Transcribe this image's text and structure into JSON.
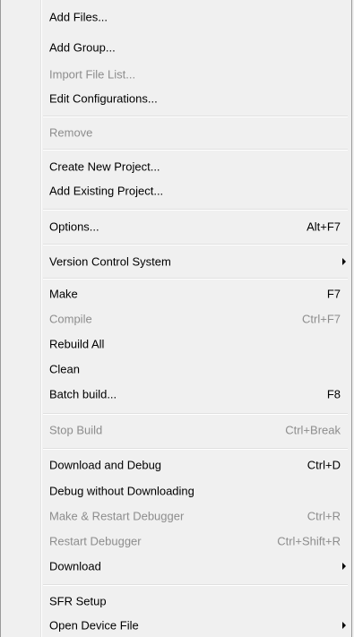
{
  "menu": {
    "items": [
      {
        "label": "Add Files...",
        "shortcut": "",
        "enabled": true,
        "submenu": false
      },
      {
        "label": "Add Group...",
        "shortcut": "",
        "enabled": true,
        "submenu": false
      },
      {
        "label": "Import File List...",
        "shortcut": "",
        "enabled": false,
        "submenu": false
      },
      {
        "label": "Edit Configurations...",
        "shortcut": "",
        "enabled": true,
        "submenu": false
      },
      {
        "label": "Remove",
        "shortcut": "",
        "enabled": false,
        "submenu": false
      },
      {
        "label": "Create New Project...",
        "shortcut": "",
        "enabled": true,
        "submenu": false
      },
      {
        "label": "Add Existing Project...",
        "shortcut": "",
        "enabled": true,
        "submenu": false
      },
      {
        "label": "Options...",
        "shortcut": "Alt+F7",
        "enabled": true,
        "submenu": false
      },
      {
        "label": "Version Control System",
        "shortcut": "",
        "enabled": true,
        "submenu": true
      },
      {
        "label": "Make",
        "shortcut": "F7",
        "enabled": true,
        "submenu": false
      },
      {
        "label": "Compile",
        "shortcut": "Ctrl+F7",
        "enabled": false,
        "submenu": false
      },
      {
        "label": "Rebuild All",
        "shortcut": "",
        "enabled": true,
        "submenu": false
      },
      {
        "label": "Clean",
        "shortcut": "",
        "enabled": true,
        "submenu": false
      },
      {
        "label": "Batch build...",
        "shortcut": "F8",
        "enabled": true,
        "submenu": false
      },
      {
        "label": "Stop Build",
        "shortcut": "Ctrl+Break",
        "enabled": false,
        "submenu": false
      },
      {
        "label": "Download and Debug",
        "shortcut": "Ctrl+D",
        "enabled": true,
        "submenu": false
      },
      {
        "label": "Debug without Downloading",
        "shortcut": "",
        "enabled": true,
        "submenu": false
      },
      {
        "label": "Make & Restart Debugger",
        "shortcut": "Ctrl+R",
        "enabled": false,
        "submenu": false
      },
      {
        "label": "Restart Debugger",
        "shortcut": "Ctrl+Shift+R",
        "enabled": false,
        "submenu": false
      },
      {
        "label": "Download",
        "shortcut": "",
        "enabled": true,
        "submenu": true
      },
      {
        "label": "SFR Setup",
        "shortcut": "",
        "enabled": true,
        "submenu": false
      },
      {
        "label": "Open Device File",
        "shortcut": "",
        "enabled": true,
        "submenu": true
      }
    ],
    "colors": {
      "background": "#f0f0f0",
      "text": "#000000",
      "disabled_text": "#8d8d8d",
      "separator": "#e0e0e0"
    }
  }
}
